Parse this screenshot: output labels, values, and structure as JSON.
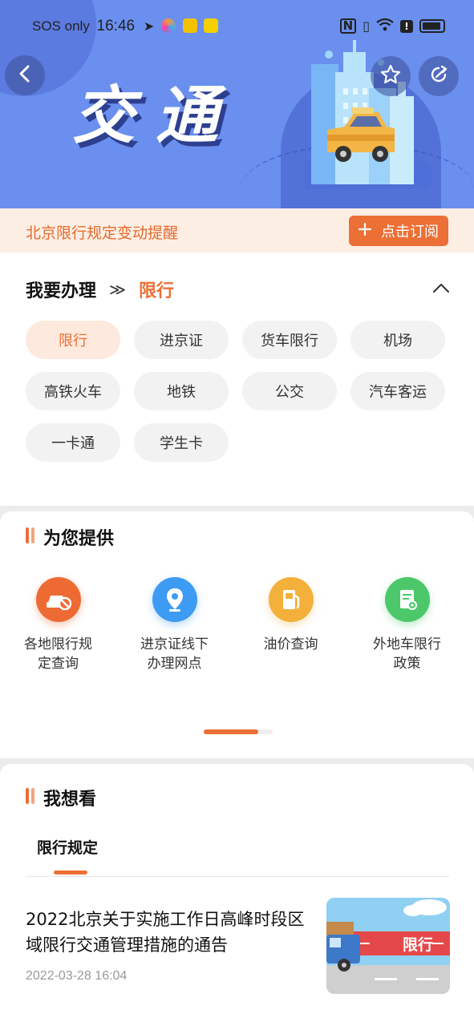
{
  "status_bar": {
    "carrier": "SOS only",
    "time": "16:46"
  },
  "hero": {
    "title": "交通"
  },
  "subscribe": {
    "notice": "北京限行规定变动提醒",
    "button": "点击订阅"
  },
  "handle": {
    "title": "我要办理",
    "separator": "≫",
    "current": "限行",
    "chips": [
      "限行",
      "进京证",
      "货车限行",
      "机场",
      "高铁火车",
      "地铁",
      "公交",
      "汽车客运",
      "一卡通",
      "学生卡"
    ]
  },
  "provide": {
    "title": "为您提供",
    "services": [
      {
        "line1": "各地限行规",
        "line2": "定查询",
        "icon": "car-restriction-icon",
        "color": "#ee6a33"
      },
      {
        "line1": "进京证线下",
        "line2": "办理网点",
        "icon": "location-pin-icon",
        "color": "#3d9bf3"
      },
      {
        "line1": "油价查询",
        "line2": "",
        "icon": "fuel-pump-icon",
        "color": "#f3b03a"
      },
      {
        "line1": "外地车限行",
        "line2": "政策",
        "icon": "policy-document-icon",
        "color": "#4cc86b"
      }
    ],
    "page_progress": 0.79
  },
  "watch": {
    "title": "我想看",
    "tab": "限行规定",
    "news": {
      "title": "2022北京关于实施工作日高峰时段区域限行交通管理措施的通告",
      "time": "2022-03-28 16:04",
      "thumb_label": "限行"
    }
  },
  "colors": {
    "accent": "#ec6f35",
    "hero_bg": "#6a8fef"
  }
}
